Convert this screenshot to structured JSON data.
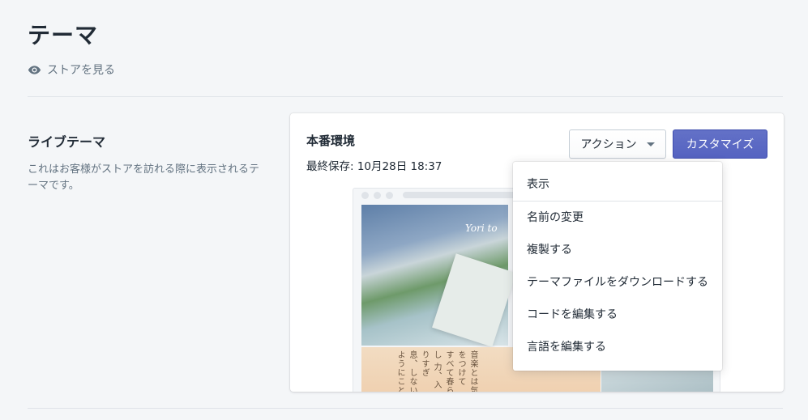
{
  "header": {
    "title": "テーマ",
    "view_store": "ストアを見る",
    "view_icon": "eye-icon"
  },
  "live_theme": {
    "title": "ライブテーマ",
    "description": "これはお客様がストアを訪れる際に表示されるテーマです。"
  },
  "card": {
    "name": "本番環境",
    "last_saved": "最終保存: 10月28日 18:37",
    "actions_label": "アクション",
    "customize_label": "カスタマイズ"
  },
  "preview": {
    "logo_text": "Yori to",
    "book_text": "音楽とは気をつけて すべて春らし 力、入りすぎ 息、しないようにこと"
  },
  "menu": {
    "items": [
      "表示",
      "名前の変更",
      "複製する",
      "テーマファイルをダウンロードする",
      "コードを編集する",
      "言語を編集する"
    ]
  },
  "colors": {
    "primary": "#5c6ac4",
    "background": "#f4f6f8",
    "text": "#212b36",
    "subdued": "#637381"
  }
}
